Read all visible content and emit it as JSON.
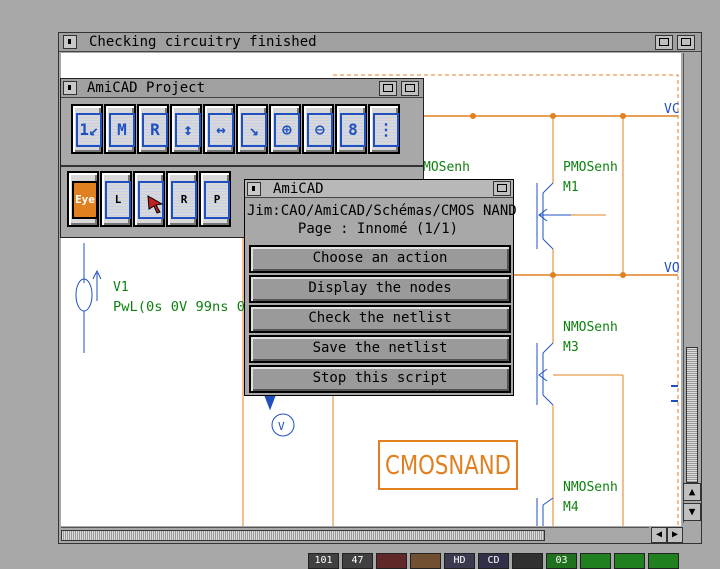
{
  "main_window": {
    "title": "Checking circuitry finished"
  },
  "project_window": {
    "title": "AmiCAD Project"
  },
  "toolbar_row1": [
    {
      "glyph": "1↙",
      "icon": "number-one-tool-icon"
    },
    {
      "glyph": "M",
      "icon": "m-tool-icon"
    },
    {
      "glyph": "R",
      "icon": "r-tool-icon"
    },
    {
      "glyph": "↕",
      "icon": "vertical-arrows-icon"
    },
    {
      "glyph": "↔",
      "icon": "horizontal-arrows-icon"
    },
    {
      "glyph": "↘",
      "icon": "select-area-icon"
    },
    {
      "glyph": "⊕",
      "icon": "zoom-in-icon"
    },
    {
      "glyph": "⊖",
      "icon": "zoom-out-icon"
    },
    {
      "glyph": "8",
      "icon": "component-tool-icon"
    },
    {
      "glyph": "⋮",
      "icon": "dotted-list-icon"
    }
  ],
  "toolbar_row2": [
    {
      "glyph": "Eye",
      "icon": "eye-tool-icon"
    },
    {
      "glyph": "L",
      "icon": "load-disk-icon"
    },
    {
      "glyph": "→",
      "icon": "save-disk-icon"
    },
    {
      "glyph": "R",
      "icon": "revert-disk-icon"
    },
    {
      "glyph": "P",
      "icon": "print-icon"
    }
  ],
  "dialog": {
    "title": "AmiCAD",
    "path_line": "Jim:CAO/AmiCAD/Schémas/CMOS NAND",
    "page_line": "Page : Innomé (1/1)",
    "buttons": [
      "Choose an action",
      "Display the nodes",
      "Check the netlist",
      "Save the netlist",
      "Stop this script"
    ]
  },
  "schematic": {
    "labels": {
      "vc": "VC",
      "vo": "VO",
      "pmos_left": "MOSenh",
      "pmos_right": "PMOSenh",
      "m1": "M1",
      "nmos_mid": "NMOSenh",
      "m3": "M3",
      "nmos_low": "NMOSenh",
      "m4": "M4",
      "v1": "V1",
      "pwl": "PwL(0s 0V 99ns 0",
      "voltmeter": "V",
      "block": "CMOSNAND"
    }
  },
  "status_bar": [
    "101",
    "47",
    "",
    "",
    "HD",
    "CD",
    "",
    "03",
    "",
    "",
    ""
  ],
  "colors": {
    "wire": "#e08020",
    "component": "#2050c0",
    "text_green": "#108010",
    "dialog_bg": "#a8a8a8"
  }
}
